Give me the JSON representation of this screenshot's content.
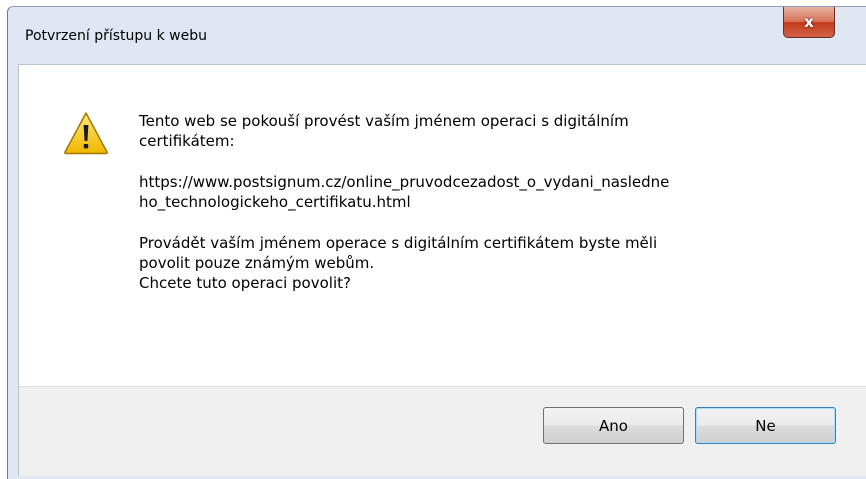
{
  "dialog": {
    "title": "Potvrzení přístupu k webu",
    "close_label": "x",
    "icon": "warning-icon",
    "message_intro": "Tento web se pokouší provést vaším jménem operaci s digitálním\ncertifikátem:",
    "url": "https://www.postsignum.cz/online_pruvodcezadost_o_vydani_nasledne\nho_technologickeho_certifikatu.html",
    "message_warning": "Provádět vaším jménem operace s digitálním certifikátem byste měli\npovolit pouze známým webům.\nChcete tuto operaci povolit?",
    "buttons": {
      "yes_label": "Ano",
      "no_label": "Ne"
    }
  },
  "colors": {
    "frame": "#dee7f2",
    "close_button": "#c2391b",
    "footer": "#f0f0f0",
    "warning_fill": "#f5c400"
  }
}
